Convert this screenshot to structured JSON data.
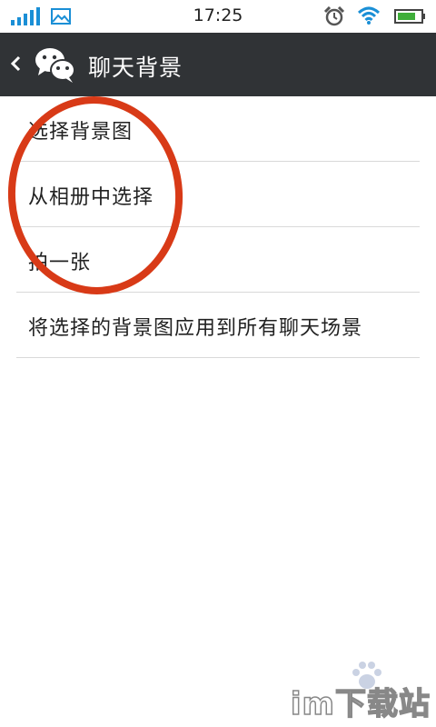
{
  "status_bar": {
    "time": "17:25",
    "icons": [
      "signal-icon",
      "gallery-icon",
      "alarm-icon",
      "wifi-icon",
      "battery-icon"
    ],
    "icon_color": "#1a8fd6"
  },
  "title_bar": {
    "back_icon": "chevron-left-icon",
    "app_icon": "wechat-icon",
    "title": "聊天背景",
    "background": "#303336"
  },
  "menu": {
    "items": [
      {
        "label": "选择背景图"
      },
      {
        "label": "从相册中选择"
      },
      {
        "label": "拍一张"
      },
      {
        "label": "将选择的背景图应用到所有聊天场景"
      }
    ]
  },
  "annotation": {
    "shape": "circle",
    "color": "#d83a17"
  },
  "watermark": {
    "text": "im下载站"
  }
}
